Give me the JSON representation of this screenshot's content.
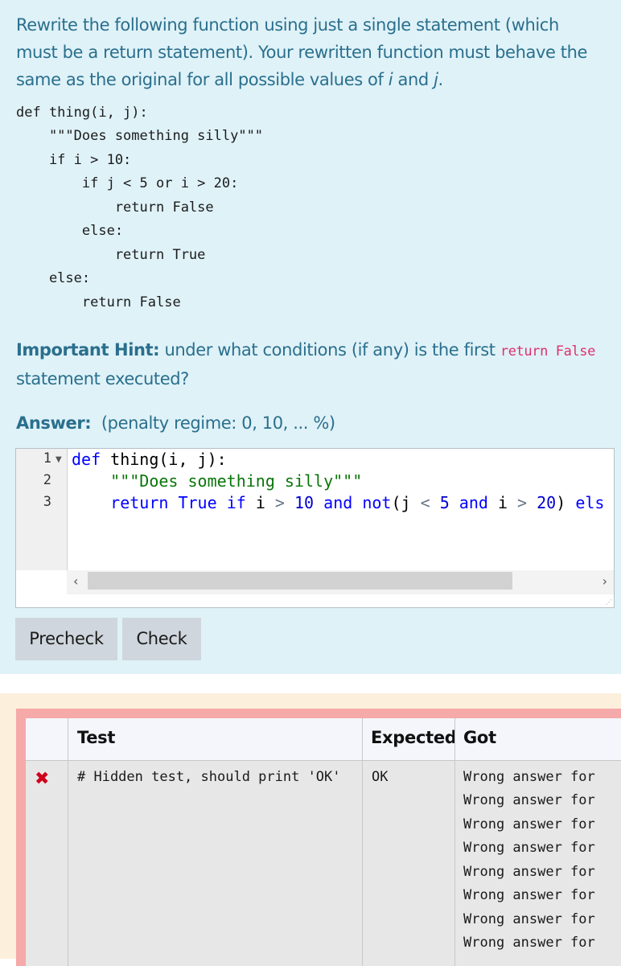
{
  "question": {
    "prompt_part1": "Rewrite the following function using just a single statement (which must be a return statement). Your rewritten function must behave the same as the original for all possible values of ",
    "var_i": "i",
    "and_text": " and ",
    "var_j": "j",
    "period": ".",
    "code_lines": [
      "def thing(i, j):",
      "    \"\"\"Does something silly\"\"\"",
      "    if i > 10:",
      "        if j < 5 or i > 20:",
      "            return False",
      "        else:",
      "            return True",
      "    else:",
      "        return False"
    ],
    "hint_label": "Important Hint:",
    "hint_text_before": " under what conditions (if any) is the first ",
    "hint_code": "return False",
    "hint_text_after": " statement executed?"
  },
  "answer": {
    "label": "Answer:",
    "regime": "(penalty regime: 0, 10, ... %)",
    "line_numbers": [
      "1",
      "2",
      "3"
    ],
    "line1": {
      "kw": "def",
      "rest": " thing(i, j):"
    },
    "line2": {
      "indent": "    ",
      "str": "\"\"\"Does something silly\"\"\""
    },
    "line3": {
      "indent": "    ",
      "return": "return",
      "true": "True",
      "if": "if",
      "i1": "i",
      "gt1": ">",
      "n10": "10",
      "and1": "and",
      "not": "not",
      "paren_j": "(j",
      "lt": "<",
      "n5": "5",
      "and2": "and",
      "i2": "i",
      "gt2": ">",
      "n20": "20",
      "close": ")",
      "els": "els"
    }
  },
  "buttons": {
    "precheck": "Precheck",
    "check": "Check"
  },
  "results": {
    "headers": {
      "test": "Test",
      "expected": "Expected",
      "got": "Got"
    },
    "row": {
      "test": "# Hidden test, should print 'OK'",
      "expected": "OK",
      "got_lines": [
        "Wrong answer for",
        "Wrong answer for",
        "Wrong answer for",
        "Wrong answer for",
        "Wrong answer for",
        "Wrong answer for",
        "Wrong answer for",
        "Wrong answer for"
      ]
    }
  }
}
